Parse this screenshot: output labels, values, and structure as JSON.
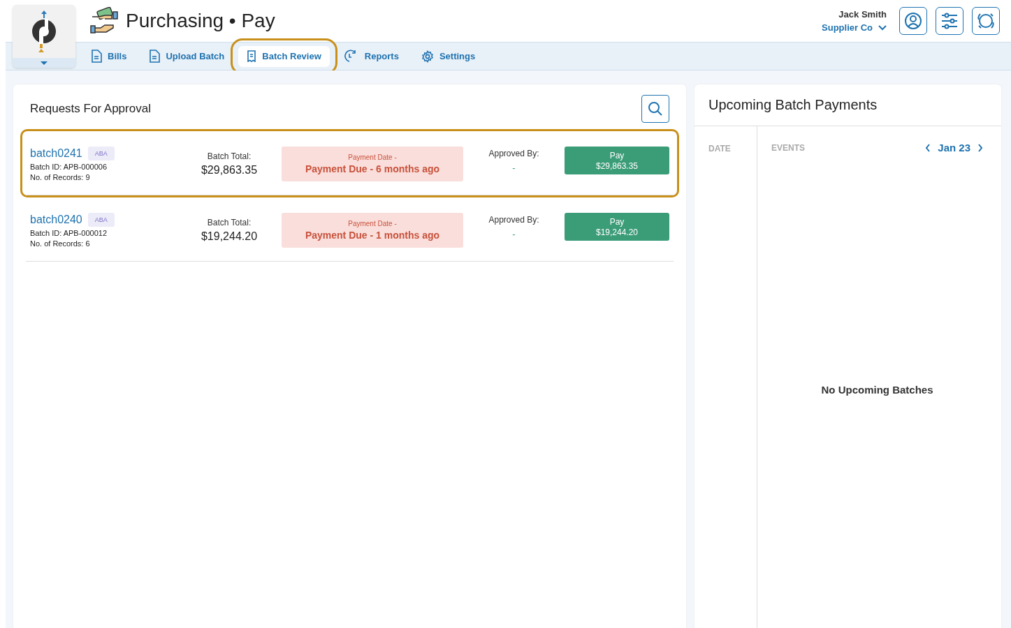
{
  "app": {
    "title": "Purchasing • Pay"
  },
  "user": {
    "name": "Jack Smith",
    "company": "Supplier Co"
  },
  "tabs": [
    {
      "label": "Bills",
      "selected": false,
      "highlighted": false
    },
    {
      "label": "Upload Batch",
      "selected": false,
      "highlighted": false
    },
    {
      "label": "Batch Review",
      "selected": true,
      "highlighted": true
    },
    {
      "label": "Reports",
      "selected": false,
      "highlighted": false
    },
    {
      "label": "Settings",
      "selected": false,
      "highlighted": false
    }
  ],
  "requests": {
    "title": "Requests For Approval",
    "batches": [
      {
        "name": "batch0241",
        "tag": "ABA",
        "batch_id": "Batch ID: APB-000006",
        "records": "No. of Records: 9",
        "total_label": "Batch Total:",
        "total": "$29,863.35",
        "date_label": "Payment Date -",
        "due": "Payment Due - 6 months ago",
        "approved_label": "Approved By:",
        "approved_by": "-",
        "pay_label": "Pay",
        "pay_amount": "$29,863.35",
        "highlighted": true
      },
      {
        "name": "batch0240",
        "tag": "ABA",
        "batch_id": "Batch ID: APB-000012",
        "records": "No. of Records: 6",
        "total_label": "Batch Total:",
        "total": "$19,244.20",
        "date_label": "Payment Date -",
        "due": "Payment Due - 1 months ago",
        "approved_label": "Approved By:",
        "approved_by": "-",
        "pay_label": "Pay",
        "pay_amount": "$19,244.20",
        "highlighted": false
      }
    ]
  },
  "upcoming": {
    "title": "Upcoming Batch Payments",
    "date_header": "DATE",
    "events_header": "EVENTS",
    "month": "Jan 23",
    "empty": "No Upcoming Batches"
  }
}
